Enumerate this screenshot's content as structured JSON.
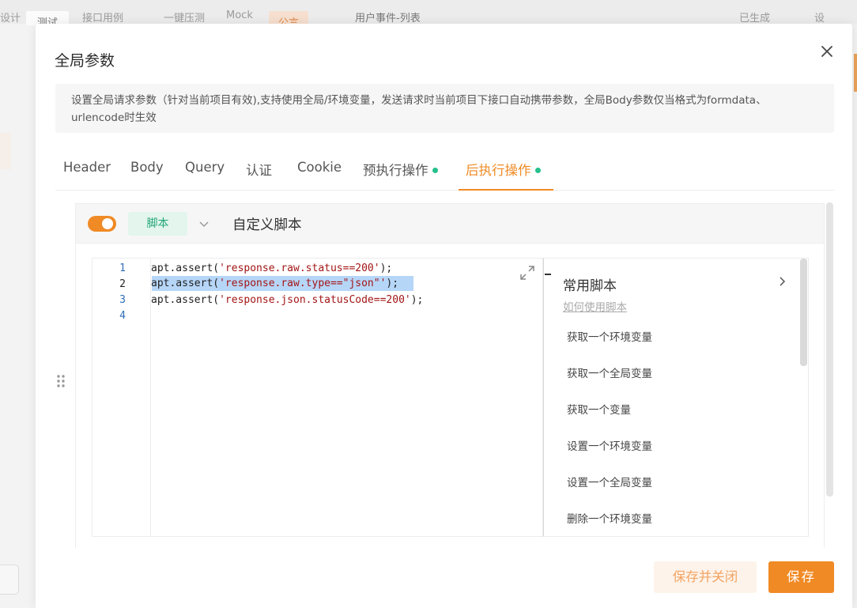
{
  "background": {
    "tabs": [
      "设计",
      "测试",
      "接口用例",
      "一键压测",
      "Mock",
      "公言",
      "用户事件-列表",
      "已生成",
      "设"
    ]
  },
  "modal": {
    "title": "全局参数",
    "notice": "设置全局请求参数（针对当前项目有效),支持使用全局/环境变量，发送请求时当前项目下接口自动携带参数，全局Body参数仅当格式为formdata、urlencode时生效"
  },
  "tabs": [
    {
      "label": "Header",
      "dot": false,
      "active": false
    },
    {
      "label": "Body",
      "dot": false,
      "active": false
    },
    {
      "label": "Query",
      "dot": false,
      "active": false
    },
    {
      "label": "认证",
      "dot": false,
      "active": false
    },
    {
      "label": "Cookie",
      "dot": false,
      "active": false
    },
    {
      "label": "预执行操作",
      "dot": true,
      "active": false
    },
    {
      "label": "后执行操作",
      "dot": true,
      "active": true
    }
  ],
  "script_panel": {
    "enabled": true,
    "type_label": "脚本",
    "title": "自定义脚本"
  },
  "editor": {
    "line_numbers": [
      "1",
      "2",
      "3",
      "4"
    ],
    "current_line": 2,
    "lines": [
      {
        "pre": "apt.assert(",
        "str": "'response.raw.status==200'",
        "post": ");"
      },
      {
        "pre": "apt.assert(",
        "str": "'response.raw.type==\"json\"'",
        "post": ");"
      },
      {
        "pre": "apt.assert(",
        "str": "'response.json.statusCode==200'",
        "post": ");"
      },
      {
        "pre": "",
        "str": "",
        "post": ""
      }
    ]
  },
  "snippets": {
    "title": "常用脚本",
    "help_link": "如何使用脚本",
    "items": [
      "获取一个环境变量",
      "获取一个全局变量",
      "获取一个变量",
      "设置一个环境变量",
      "设置一个全局变量",
      "删除一个环境变量"
    ]
  },
  "footer": {
    "save_close_label": "保存并关闭",
    "save_label": "保存"
  },
  "colors": {
    "accent": "#f08a24",
    "success": "#25c08b"
  }
}
